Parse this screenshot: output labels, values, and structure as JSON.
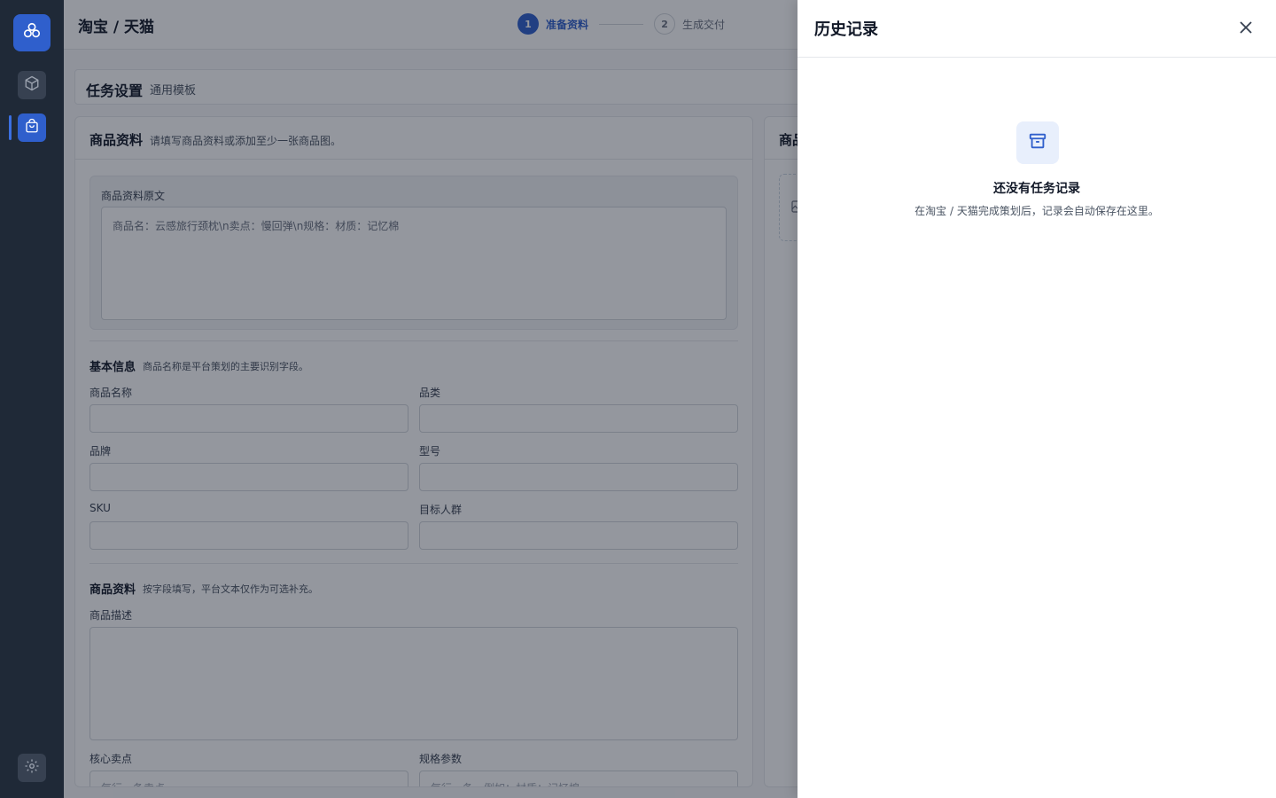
{
  "header": {
    "breadcrumb": "淘宝 / 天猫",
    "steps": [
      {
        "num": "1",
        "label": "准备资料",
        "state": "active"
      },
      {
        "num": "2",
        "label": "生成交付",
        "state": "idle"
      }
    ]
  },
  "task": {
    "title": "任务设置",
    "template": "通用模板"
  },
  "product_card": {
    "title": "商品资料",
    "hint": "请填写商品资料或添加至少一张商品图。",
    "raw_label": "商品资料原文",
    "raw_value": "商品名：云感旅行颈枕\\n卖点：慢回弹\\n规格：材质：记忆棉",
    "basic_title": "基本信息",
    "basic_hint": "商品名称是平台策划的主要识别字段。",
    "fields": {
      "name": "商品名称",
      "category": "品类",
      "brand": "品牌",
      "model": "型号",
      "sku": "SKU",
      "audience": "目标人群"
    },
    "detail_title": "商品资料",
    "detail_hint": "按字段填写，平台文本仅作为可选补充。",
    "desc_label": "商品描述",
    "selling_label": "核心卖点",
    "selling_placeholder": "每行一条卖点",
    "spec_label": "规格参数",
    "spec_placeholder": "每行一条，例如：材质：记忆棉"
  },
  "image_card": {
    "title": "商品图"
  },
  "drawer": {
    "title": "历史记录",
    "empty_title": "还没有任务记录",
    "empty_desc": "在淘宝 / 天猫完成策划后，记录会自动保存在这里。"
  },
  "colors": {
    "accent": "#2f5fcc",
    "rail": "#1f2937",
    "overlay": "rgba(17,24,39,0.45)"
  },
  "icons": [
    "logo-icon",
    "box-icon",
    "shopping-bag-icon",
    "gear-icon",
    "close-icon",
    "archive-icon",
    "image-icon"
  ]
}
